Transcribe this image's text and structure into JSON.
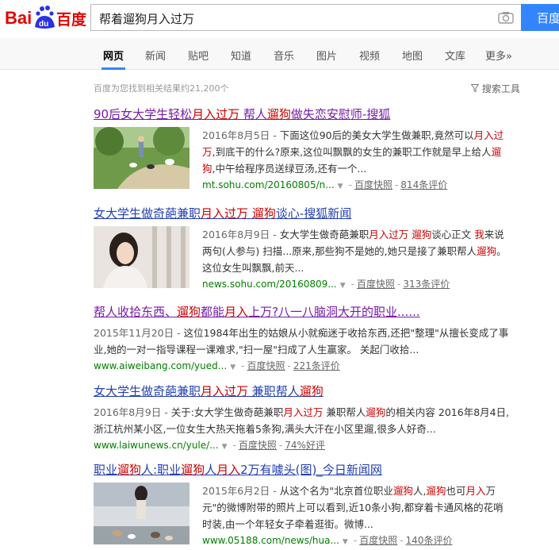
{
  "header": {
    "logo_text_left": "Bai",
    "logo_text_paw": "du",
    "logo_text_right": "百度",
    "query": "帮着遛狗月入过万",
    "search_button": "百度"
  },
  "tabs": [
    {
      "label": "网页"
    },
    {
      "label": "新闻"
    },
    {
      "label": "贴吧"
    },
    {
      "label": "知道"
    },
    {
      "label": "音乐"
    },
    {
      "label": "图片"
    },
    {
      "label": "视频"
    },
    {
      "label": "地图"
    },
    {
      "label": "文库"
    },
    {
      "label": "更多»"
    }
  ],
  "stats": "百度为您找到相关结果约21,200个",
  "tools_label": "搜索工具",
  "results": [
    {
      "title": [
        "90后女大学生轻松",
        "月入过万",
        " 帮人",
        "遛狗",
        "做失恋安慰师-搜狐"
      ],
      "lines": [
        [
          "2016年8月5日 - ",
          "下面这位90后的美女大学生做兼职,竟然可以",
          "月入过"
        ],
        [
          "万",
          ",到底干的什么?原来,这位叫飘飘的女生的兼职工作就是早上给人",
          "遛"
        ],
        [
          "狗",
          ",中午给程序员送绿豆汤,还有一个..."
        ]
      ],
      "url": "mt.sohu.com/20160805/n...",
      "snapshot": "百度快照",
      "extra": "814条评价"
    },
    {
      "title": [
        "女大学生做奇葩兼职",
        "月入过万",
        " ",
        "遛狗",
        "谈心-搜狐新闻"
      ],
      "lines": [
        [
          "2016年8月9日 - ",
          "女大学生做奇葩兼职",
          "月入过万",
          " ",
          "遛狗",
          "谈心正文 ",
          "我",
          "来说"
        ],
        [
          "两句(人参与) 扫描...原来,那些狗不是她的,她只是接了兼职帮人",
          "遛狗",
          "。"
        ],
        [
          "这位女生叫飘飘,前天..."
        ]
      ],
      "url": "news.sohu.com/20160809...",
      "snapshot": "百度快照",
      "extra": "313条评价"
    },
    {
      "title": [
        "帮人收拾东西、",
        "遛狗",
        "都能",
        "月入",
        "上万?八一八脑洞大开的职业......"
      ],
      "lines": [
        [
          "2015年11月20日 - ",
          "这位1984年出生的姑娘从小就痴迷于收拾东西,还把\"整理\"从擅长变成了事"
        ],
        [
          "业,她的一对一指导课程一课难求,\"扫一屋\"扫成了人生赢家。 关起门收拾..."
        ]
      ],
      "url": "www.aiweibang.com/yued...",
      "snapshot": "百度快照",
      "extra": "221条评价"
    },
    {
      "title": [
        "女大学生做奇葩兼职",
        "月入过万",
        " 兼职帮人",
        "遛狗"
      ],
      "lines": [
        [
          "2016年8月9日 - ",
          "关于:女大学生做奇葩兼职",
          "月入过万",
          " 兼职帮人",
          "遛狗",
          "的相关内容 2016年8月4日,"
        ],
        [
          "浙江杭州某小区,一位女生大热天拖着5条狗,满头大汗在小区里遛,很多人好奇..."
        ]
      ],
      "url": "www.laiwunews.cn/yule/...",
      "snapshot": "百度快照",
      "extra": "74%好评"
    },
    {
      "title": [
        "职业",
        "遛狗",
        "人:职业",
        "遛狗",
        "人",
        "月入",
        "2万有噱头(图)_今日新闻网"
      ],
      "lines": [
        [
          "2015年6月2日 - ",
          "从这个名为\"北京首位职业",
          "遛狗",
          "人,",
          "遛狗",
          "也可",
          "月入",
          "万"
        ],
        [
          "元\"的微博附带的照片上可以看到,近10条小狗,都穿着卡通风格的花哨"
        ],
        [
          "时装,由一个年轻女子牵着逛街。微博..."
        ]
      ],
      "url": "www.05188.com/news/hua...",
      "snapshot": "百度快照",
      "extra": "140条评价"
    }
  ]
}
